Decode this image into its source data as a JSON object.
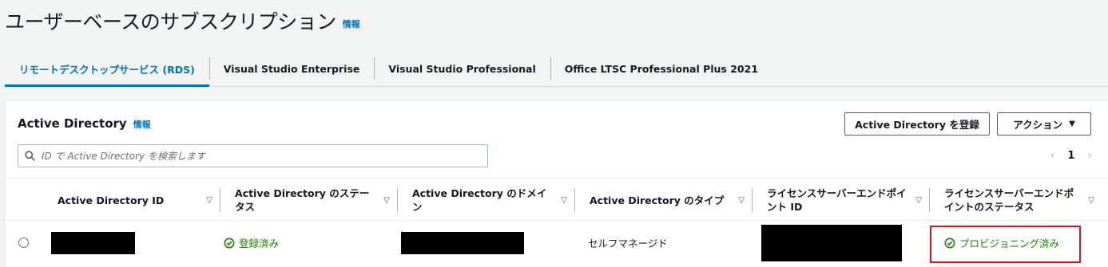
{
  "page": {
    "title": "ユーザーベースのサブスクリプション",
    "info_link": "情報"
  },
  "tabs": [
    {
      "label": "リモートデスクトップサービス (RDS)",
      "active": true
    },
    {
      "label": "Visual Studio Enterprise",
      "active": false
    },
    {
      "label": "Visual Studio Professional",
      "active": false
    },
    {
      "label": "Office LTSC Professional Plus 2021",
      "active": false
    }
  ],
  "container": {
    "title": "Active Directory",
    "info_link": "情報",
    "register_button": "Active Directory を登録",
    "actions_button": "アクション",
    "search_placeholder": "ID で Active Directory を検索します",
    "pagination": {
      "current_page": "1",
      "prev": "‹",
      "next": "›"
    }
  },
  "table": {
    "columns": [
      "Active Directory ID",
      "Active Directory のステータス",
      "Active Directory のドメイン",
      "Active Directory のタイプ",
      "ライセンスサーバーエンドポイント ID",
      "ライセンスサーバーエンドポイントのステータス"
    ],
    "rows": [
      {
        "id": "",
        "status": "登録済み",
        "domain": "",
        "type": "セルフマネージド",
        "endpoint_id": "",
        "endpoint_status": "プロビジョニング済み"
      }
    ]
  },
  "colors": {
    "accent": "#0073bb",
    "success": "#1d8102",
    "highlight": "#e0141e",
    "redaction": "#000000"
  },
  "icons": {
    "search": "search-icon",
    "status_ok": "check-circle-icon",
    "sort": "sort-caret-icon",
    "dropdown": "caret-down-icon"
  }
}
